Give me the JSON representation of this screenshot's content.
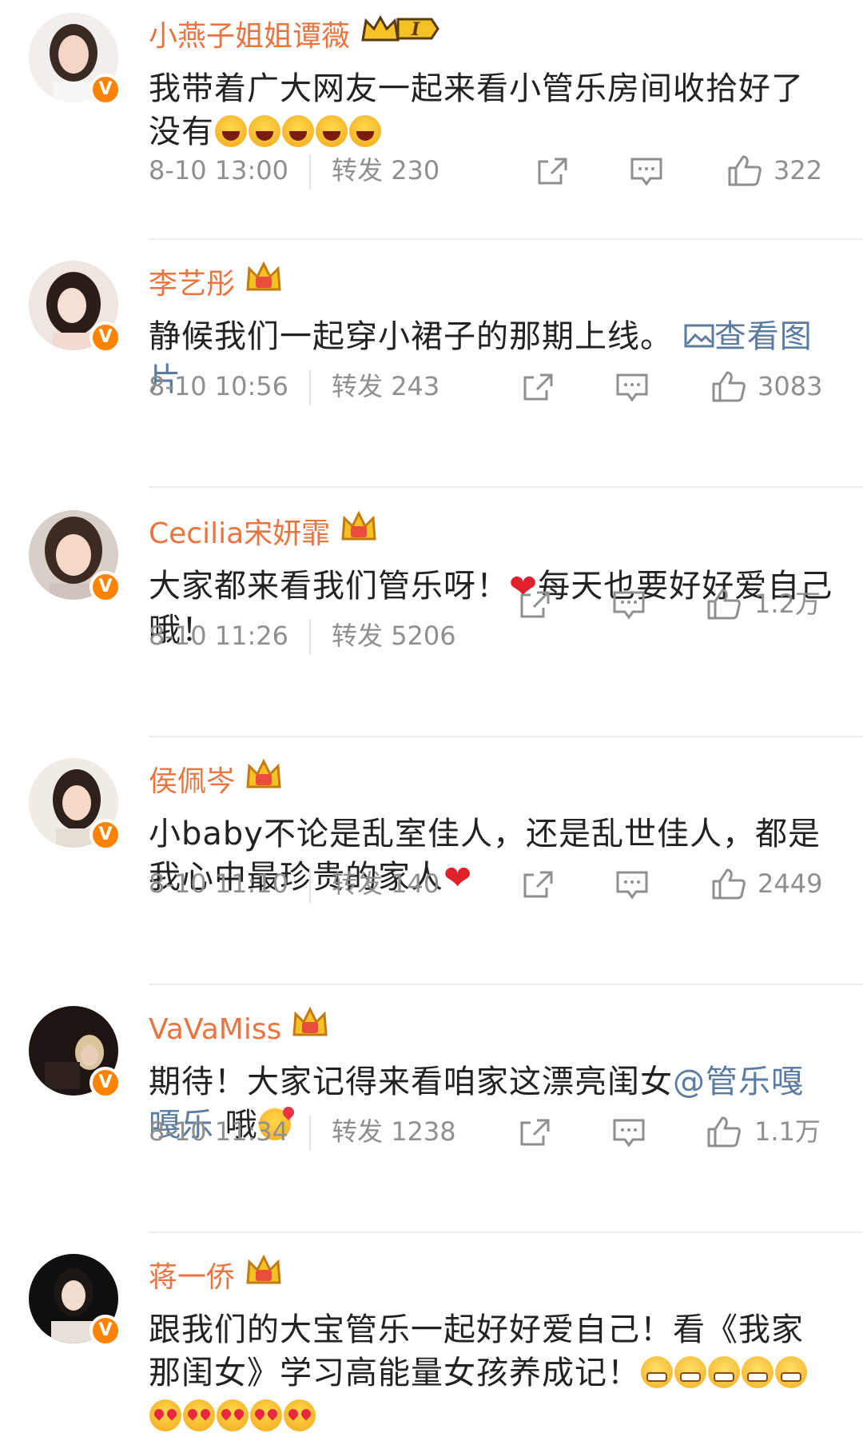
{
  "comments": [
    {
      "author": "小燕子姐姐谭薇",
      "badge_text": "I",
      "text_parts": [
        "我带着广大网友一起来看小管乐房间收拾好了没有"
      ],
      "emojis": [
        "laugh",
        "laugh",
        "laugh",
        "laugh",
        "laugh"
      ],
      "time": "8-10 13:00",
      "forward_label": "转发 230",
      "likes": "322"
    },
    {
      "author": "李艺彤",
      "text_parts": [
        "静候我们一起穿小裙子的那期上线。"
      ],
      "link": "查看图片",
      "time": "8-10 10:56",
      "forward_label": "转发 243",
      "likes": "3083"
    },
    {
      "author": "Cecilia宋妍霏",
      "text_parts": [
        "大家都来看我们管乐呀！",
        "每天也要好好爱自己哦！"
      ],
      "time": "8-10 11:26",
      "forward_label": "转发 5206",
      "likes": "1.2万"
    },
    {
      "author": "侯佩岑",
      "text_parts": [
        "小baby不论是乱室佳人，还是乱世佳人，都是我心中最珍贵的家人"
      ],
      "time": "8-10 11:10",
      "forward_label": "转发 140",
      "likes": "2449"
    },
    {
      "author": "VaVaMiss",
      "text_parts": [
        "期待！大家记得来看咱家这漂亮闺女",
        " 哦"
      ],
      "mention": "@管乐嘎嘎乐",
      "time": "8-10 11:34",
      "forward_label": "转发 1238",
      "likes": "1.1万"
    },
    {
      "author": "蒋一侨",
      "text_parts": [
        "跟我们的大宝管乐一起好好爱自己！看《我家那闺女》学习高能量女孩养成记！"
      ]
    }
  ],
  "colors": {
    "name": "#eb7340",
    "link": "#5b7ba0",
    "meta": "#8f8f8f",
    "verified": "#ff8200"
  },
  "icons": {
    "verified": "V",
    "forward": "share-icon",
    "comment": "comment-icon",
    "like": "thumbs-up-icon"
  }
}
